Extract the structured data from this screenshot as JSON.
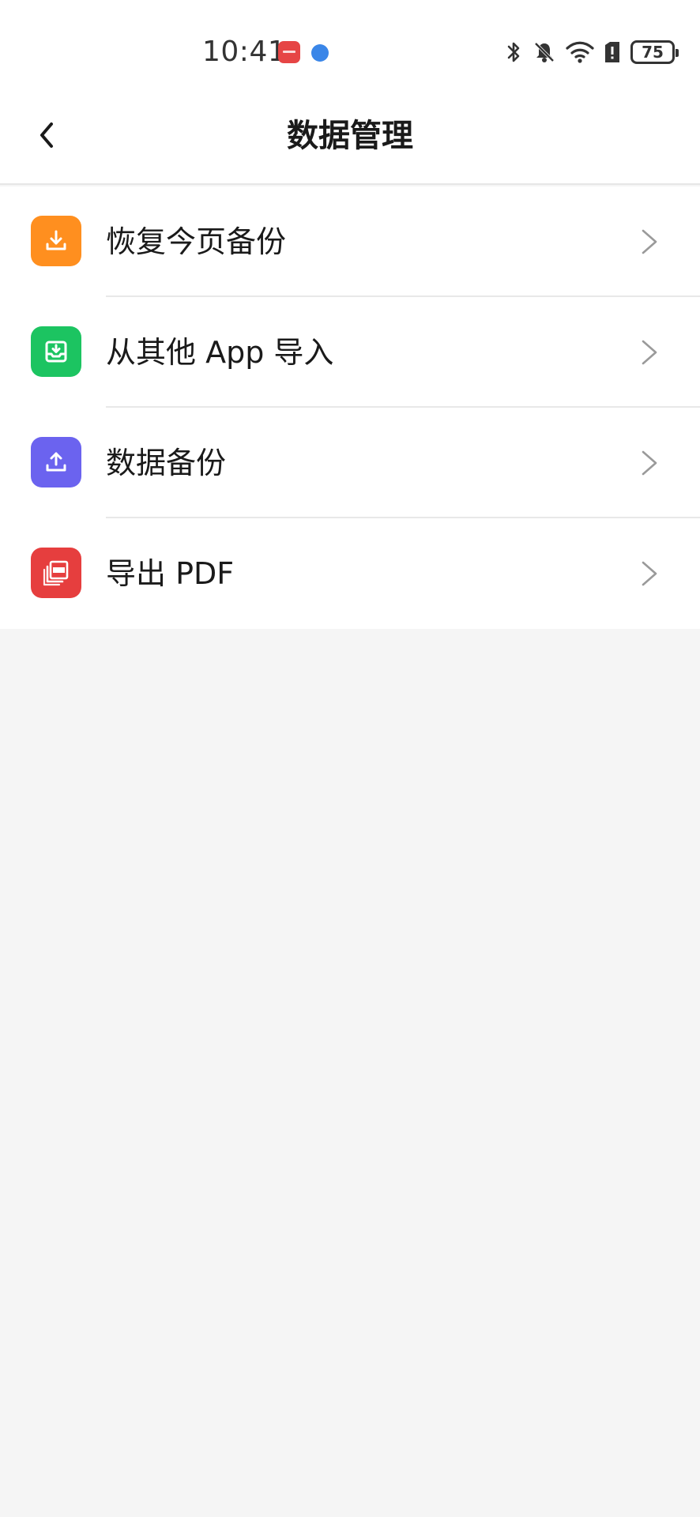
{
  "status_bar": {
    "time": "10:41",
    "battery": "75"
  },
  "header": {
    "title": "数据管理"
  },
  "menu": [
    {
      "label": "恢复今页备份",
      "icon": "download-icon",
      "color": "#ff8f1f"
    },
    {
      "label": "从其他 App 导入",
      "icon": "import-icon",
      "color": "#1cc461"
    },
    {
      "label": "数据备份",
      "icon": "upload-icon",
      "color": "#6b63ef"
    },
    {
      "label": "导出 PDF",
      "icon": "pdf-icon",
      "color": "#e63e3e"
    }
  ],
  "colors": {
    "background": "#f5f5f5",
    "surface": "#ffffff",
    "divider": "#e8e8e8",
    "chevron": "#9a9a9a"
  }
}
